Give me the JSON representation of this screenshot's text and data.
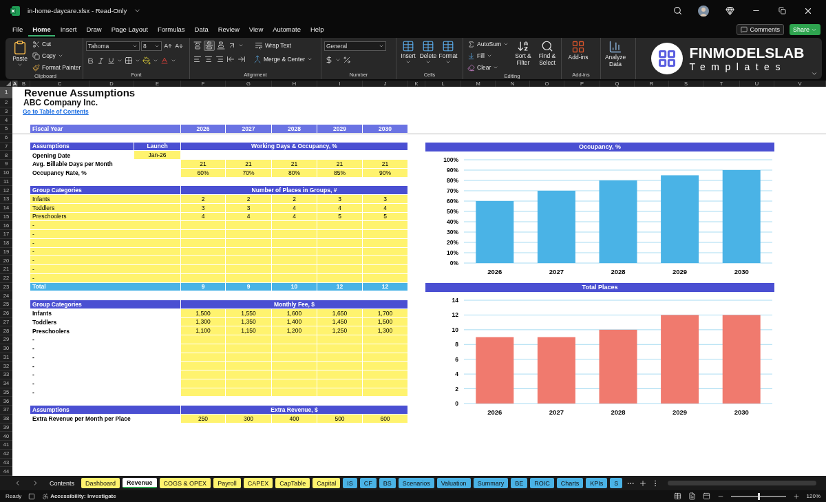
{
  "window": {
    "title": "in-home-daycare.xlsx - Read-Only"
  },
  "menu_tabs": [
    {
      "label": "File",
      "selected": false
    },
    {
      "label": "Home",
      "selected": true
    },
    {
      "label": "Insert",
      "selected": false
    },
    {
      "label": "Draw",
      "selected": false
    },
    {
      "label": "Page Layout",
      "selected": false
    },
    {
      "label": "Formulas",
      "selected": false
    },
    {
      "label": "Data",
      "selected": false
    },
    {
      "label": "Review",
      "selected": false
    },
    {
      "label": "View",
      "selected": false
    },
    {
      "label": "Automate",
      "selected": false
    },
    {
      "label": "Help",
      "selected": false
    }
  ],
  "header_buttons": {
    "comments": "Comments",
    "share": "Share"
  },
  "ribbon": {
    "clipboard": {
      "label": "Clipboard",
      "paste": "Paste",
      "cut": "Cut",
      "copy": "Copy",
      "format_painter": "Format Painter"
    },
    "font": {
      "label": "Font",
      "font_name": "Tahoma",
      "font_size": "8"
    },
    "alignment": {
      "label": "Alignment",
      "wrap_text": "Wrap Text",
      "merge_center": "Merge & Center"
    },
    "number": {
      "label": "Number",
      "format": "General"
    },
    "cells": {
      "label": "Cells",
      "buttons": [
        "Insert",
        "Delete",
        "Format"
      ]
    },
    "editing": {
      "label": "Editing",
      "autosum": "AutoSum",
      "fill": "Fill",
      "clear": "Clear",
      "sort_filter": "Sort & Filter",
      "find_select": "Find & Select"
    },
    "addins": {
      "label": "Add-ins",
      "button": "Add-ins"
    },
    "analyze": {
      "button": "Analyze Data"
    },
    "logo": {
      "name": "FINMODELSLAB",
      "tagline": "Templates"
    }
  },
  "column_headers": [
    {
      "label": "A",
      "selected": true
    },
    {
      "label": "B",
      "selected": false
    },
    {
      "label": "C",
      "selected": false
    },
    {
      "label": "D",
      "selected": false
    },
    {
      "label": "E",
      "selected": false
    },
    {
      "label": "F",
      "selected": false
    },
    {
      "label": "G",
      "selected": false
    },
    {
      "label": "H",
      "selected": false
    },
    {
      "label": "I",
      "selected": false
    },
    {
      "label": "J",
      "selected": false
    },
    {
      "label": "K",
      "selected": false
    },
    {
      "label": "L",
      "selected": false
    },
    {
      "label": "M",
      "selected": false
    },
    {
      "label": "N",
      "selected": false
    },
    {
      "label": "O",
      "selected": false
    },
    {
      "label": "P",
      "selected": false
    },
    {
      "label": "Q",
      "selected": false
    },
    {
      "label": "R",
      "selected": false
    },
    {
      "label": "S",
      "selected": false
    },
    {
      "label": "T",
      "selected": false
    },
    {
      "label": "U",
      "selected": false
    },
    {
      "label": "V",
      "selected": false
    }
  ],
  "rows": [
    {
      "number": "1",
      "selected": true,
      "kind": "title",
      "text": "Revenue Assumptions"
    },
    {
      "number": "2",
      "selected": false,
      "kind": "subtitle",
      "text": "ABC Company Inc."
    },
    {
      "number": "3",
      "selected": false,
      "kind": "link",
      "text": "Go to Table of Contents"
    },
    {
      "number": "4",
      "selected": false,
      "kind": "blank"
    },
    {
      "number": "5",
      "selected": false,
      "kind": "year",
      "label": "Fiscal Year",
      "values": [
        "2026",
        "2027",
        "2028",
        "2029",
        "2030"
      ]
    },
    {
      "number": "6",
      "selected": false,
      "kind": "blank"
    },
    {
      "number": "7",
      "selected": false,
      "kind": "header",
      "label": "Assumptions",
      "launch": "Launch",
      "span": "Working Days & Occupancy, %"
    },
    {
      "number": "8",
      "selected": false,
      "kind": "date",
      "label": "Opening Date",
      "value": "Jan-26"
    },
    {
      "number": "9",
      "selected": false,
      "kind": "input",
      "label": "Avg. Billable Days per Month",
      "values": [
        "21",
        "21",
        "21",
        "21",
        "21"
      ]
    },
    {
      "number": "10",
      "selected": false,
      "kind": "input",
      "label": "Occupancy Rate, %",
      "values": [
        "60%",
        "70%",
        "80%",
        "85%",
        "90%"
      ]
    },
    {
      "number": "11",
      "selected": false,
      "kind": "blank"
    },
    {
      "number": "12",
      "selected": false,
      "kind": "header",
      "label": "Group Categories",
      "span": "Number of Places in Groups, #"
    },
    {
      "number": "13",
      "selected": false,
      "kind": "group",
      "label": "Infants",
      "values": [
        "2",
        "2",
        "2",
        "3",
        "3"
      ]
    },
    {
      "number": "14",
      "selected": false,
      "kind": "group",
      "label": "Toddlers",
      "values": [
        "3",
        "3",
        "4",
        "4",
        "4"
      ]
    },
    {
      "number": "15",
      "selected": false,
      "kind": "group",
      "label": "Preschoolers",
      "values": [
        "4",
        "4",
        "4",
        "5",
        "5"
      ]
    },
    {
      "number": "16",
      "selected": false,
      "kind": "group",
      "label": "-"
    },
    {
      "number": "17",
      "selected": false,
      "kind": "group",
      "label": "-"
    },
    {
      "number": "18",
      "selected": false,
      "kind": "group",
      "label": "-"
    },
    {
      "number": "19",
      "selected": false,
      "kind": "group",
      "label": "-"
    },
    {
      "number": "20",
      "selected": false,
      "kind": "group",
      "label": "-"
    },
    {
      "number": "21",
      "selected": false,
      "kind": "group",
      "label": "-"
    },
    {
      "number": "22",
      "selected": false,
      "kind": "group",
      "label": "-"
    },
    {
      "number": "23",
      "selected": false,
      "kind": "total",
      "label": "Total",
      "values": [
        "9",
        "9",
        "10",
        "12",
        "12"
      ]
    },
    {
      "number": "24",
      "selected": false,
      "kind": "blank"
    },
    {
      "number": "25",
      "selected": false,
      "kind": "header",
      "label": "Group Categories",
      "span": "Monthly Fee, $"
    },
    {
      "number": "26",
      "selected": false,
      "kind": "input",
      "label": "Infants",
      "values": [
        "1,500",
        "1,550",
        "1,600",
        "1,650",
        "1,700"
      ]
    },
    {
      "number": "27",
      "selected": false,
      "kind": "input",
      "label": "Toddlers",
      "values": [
        "1,300",
        "1,350",
        "1,400",
        "1,450",
        "1,500"
      ]
    },
    {
      "number": "28",
      "selected": false,
      "kind": "input",
      "label": "Preschoolers",
      "values": [
        "1,100",
        "1,150",
        "1,200",
        "1,250",
        "1,300"
      ]
    },
    {
      "number": "29",
      "selected": false,
      "kind": "input",
      "label": "-"
    },
    {
      "number": "30",
      "selected": false,
      "kind": "input",
      "label": "-"
    },
    {
      "number": "31",
      "selected": false,
      "kind": "input",
      "label": "-"
    },
    {
      "number": "32",
      "selected": false,
      "kind": "input",
      "label": "-"
    },
    {
      "number": "33",
      "selected": false,
      "kind": "input",
      "label": "-"
    },
    {
      "number": "34",
      "selected": false,
      "kind": "input",
      "label": "-"
    },
    {
      "number": "35",
      "selected": false,
      "kind": "input",
      "label": "-"
    },
    {
      "number": "36",
      "selected": false,
      "kind": "blank"
    },
    {
      "number": "37",
      "selected": false,
      "kind": "header",
      "label": "Assumptions",
      "span": "Extra Revenue, $"
    },
    {
      "number": "38",
      "selected": false,
      "kind": "input",
      "label": "Extra Revenue per Month per Place",
      "values": [
        "250",
        "300",
        "400",
        "500",
        "600"
      ]
    },
    {
      "number": "39",
      "selected": false,
      "kind": "blank"
    },
    {
      "number": "40",
      "selected": false,
      "kind": "blank"
    },
    {
      "number": "41",
      "selected": false,
      "kind": "blank"
    },
    {
      "number": "42",
      "selected": false,
      "kind": "blank"
    },
    {
      "number": "43",
      "selected": false,
      "kind": "blank"
    },
    {
      "number": "44",
      "selected": false,
      "kind": "blank"
    }
  ],
  "charts": [
    {
      "chart_data": {
        "type": "bar",
        "title": "Occupancy, %",
        "categories": [
          "2026",
          "2027",
          "2028",
          "2029",
          "2030"
        ],
        "grid": true,
        "series": [
          {
            "color": "#4ab3e6",
            "values": [
              60,
              70,
              80,
              85,
              90
            ]
          }
        ],
        "ylim": [
          0,
          100
        ],
        "yticks": [
          {
            "value": 0,
            "label": "0%"
          },
          {
            "value": 10,
            "label": "10%"
          },
          {
            "value": 20,
            "label": "20%"
          },
          {
            "value": 30,
            "label": "30%"
          },
          {
            "value": 40,
            "label": "40%"
          },
          {
            "value": 50,
            "label": "50%"
          },
          {
            "value": 60,
            "label": "60%"
          },
          {
            "value": 70,
            "label": "70%"
          },
          {
            "value": 80,
            "label": "80%"
          },
          {
            "value": 90,
            "label": "90%"
          },
          {
            "value": 100,
            "label": "100%"
          }
        ]
      }
    },
    {
      "chart_data": {
        "type": "bar",
        "title": "Total Places",
        "categories": [
          "2026",
          "2027",
          "2028",
          "2029",
          "2030"
        ],
        "grid": true,
        "series": [
          {
            "color": "#f07a6e",
            "values": [
              9,
              9,
              10,
              12,
              12
            ]
          }
        ],
        "ylim": [
          0,
          14
        ],
        "yticks": [
          0,
          2,
          4,
          6,
          8,
          10,
          12,
          14
        ]
      }
    }
  ],
  "sheet_tabs": [
    {
      "label": "Contents",
      "selected": false
    },
    {
      "label": "Dashboard",
      "color": "#fff36e",
      "selected": false
    },
    {
      "label": "Revenue",
      "selected": true
    },
    {
      "label": "COGS & OPEX",
      "color": "#fff36e",
      "selected": false
    },
    {
      "label": "Payroll",
      "color": "#fff36e",
      "selected": false
    },
    {
      "label": "CAPEX",
      "color": "#fff36e",
      "selected": false
    },
    {
      "label": "CapTable",
      "color": "#fff36e",
      "selected": false
    },
    {
      "label": "Capital",
      "color": "#fff36e",
      "selected": false
    },
    {
      "label": "IS",
      "color": "#4ab3e6",
      "selected": false
    },
    {
      "label": "CF",
      "color": "#4ab3e6",
      "selected": false
    },
    {
      "label": "BS",
      "color": "#4ab3e6",
      "selected": false
    },
    {
      "label": "Scenarios",
      "color": "#4ab3e6",
      "selected": false
    },
    {
      "label": "Valuation",
      "color": "#4ab3e6",
      "selected": false
    },
    {
      "label": "Summary",
      "color": "#4ab3e6",
      "selected": false
    },
    {
      "label": "BE",
      "color": "#4ab3e6",
      "selected": false
    },
    {
      "label": "ROIC",
      "color": "#4ab3e6",
      "selected": false
    },
    {
      "label": "Charts",
      "color": "#4ab3e6",
      "selected": false
    },
    {
      "label": "KPIs",
      "color": "#4ab3e6",
      "selected": false
    },
    {
      "label": "S",
      "color": "#4ab3e6",
      "selected": false
    }
  ],
  "status_bar": {
    "state": "Ready",
    "accessibility": "Accessibility: Investigate",
    "zoom": {
      "level": 0.5,
      "reading": "120%"
    }
  }
}
